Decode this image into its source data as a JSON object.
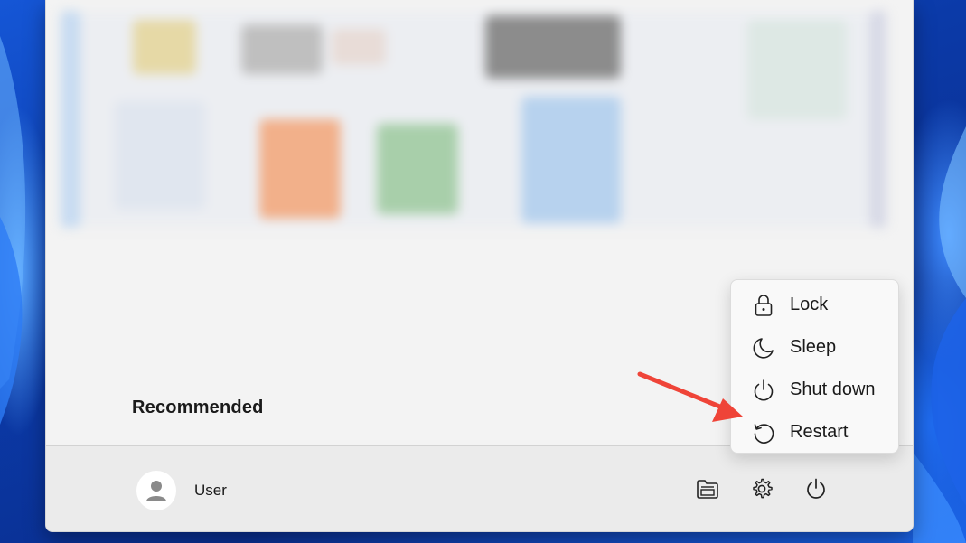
{
  "start_menu": {
    "recommended_title": "Recommended"
  },
  "footer": {
    "user_name": "User",
    "icons": [
      "file-explorer-icon",
      "settings-gear-icon",
      "power-icon"
    ]
  },
  "power_menu": {
    "items": [
      {
        "label": "Lock",
        "icon": "lock-icon"
      },
      {
        "label": "Sleep",
        "icon": "moon-icon"
      },
      {
        "label": "Shut down",
        "icon": "power-icon"
      },
      {
        "label": "Restart",
        "icon": "restart-icon"
      }
    ]
  },
  "annotation": {
    "arrow_color": "#ef4438"
  }
}
